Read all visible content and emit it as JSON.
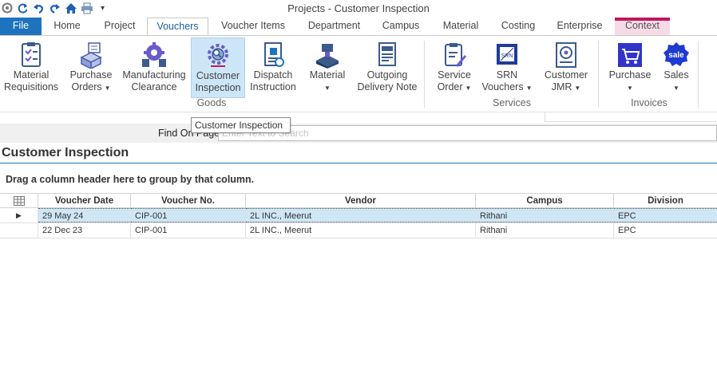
{
  "window": {
    "title": "Projects - Customer Inspection"
  },
  "quick_access": [
    {
      "icon": "gear-icon"
    },
    {
      "icon": "refresh-icon"
    },
    {
      "icon": "undo-icon"
    },
    {
      "icon": "redo-icon"
    },
    {
      "icon": "home-icon"
    },
    {
      "icon": "print-icon"
    },
    {
      "icon": "customize-dropdown-icon",
      "label": "▾"
    }
  ],
  "tabs": {
    "file": "File",
    "home": "Home",
    "project": "Project",
    "vouchers": "Vouchers",
    "voucher_items": "Voucher Items",
    "department": "Department",
    "campus": "Campus",
    "material": "Material",
    "costing": "Costing",
    "enterprise": "Enterprise",
    "context": "Context"
  },
  "ribbon": {
    "material_requisitions": [
      "Material",
      "Requisitions"
    ],
    "purchase_orders": [
      "Purchase",
      "Orders"
    ],
    "manufacturing_clearance": [
      "Manufacturing",
      "Clearance"
    ],
    "customer_inspection": [
      "Customer",
      "Inspection"
    ],
    "dispatch_instruction": [
      "Dispatch",
      "Instruction"
    ],
    "material": [
      "Material"
    ],
    "outgoing_delivery_note": [
      "Outgoing",
      "Delivery Note"
    ],
    "service_order": [
      "Service",
      "Order"
    ],
    "srn_vouchers": [
      "SRN",
      "Vouchers"
    ],
    "customer_jmr": [
      "Customer",
      "JMR"
    ],
    "purchase": [
      "Purchase"
    ],
    "sales": [
      "Sales"
    ],
    "groups": {
      "goods": "Goods",
      "services": "Services",
      "invoices": "Invoices"
    },
    "srn_icon_text": "SRN",
    "sale_icon_text": "sale"
  },
  "tooltip": "Customer Inspection",
  "find": {
    "label": "Find On Page",
    "placeholder": "Enter Text to Search",
    "value": ""
  },
  "page_title": "Customer Inspection",
  "group_hint": "Drag a column header here to group by that column.",
  "grid": {
    "columns": [
      "Voucher Date",
      "Voucher No.",
      "Vendor",
      "Campus",
      "Division"
    ],
    "rows": [
      {
        "date": "29 May 24",
        "voucher_no": "CIP-001",
        "vendor": "2L INC., Meerut",
        "campus": "Rithani",
        "division": "EPC",
        "selected": true
      },
      {
        "date": "22 Dec 23",
        "voucher_no": "CIP-001",
        "vendor": "2L INC., Meerut",
        "campus": "Rithani",
        "division": "EPC",
        "selected": false
      }
    ]
  },
  "colors": {
    "accent": "#1e73be",
    "context": "#c2185b",
    "selection": "#cfe6f5"
  }
}
